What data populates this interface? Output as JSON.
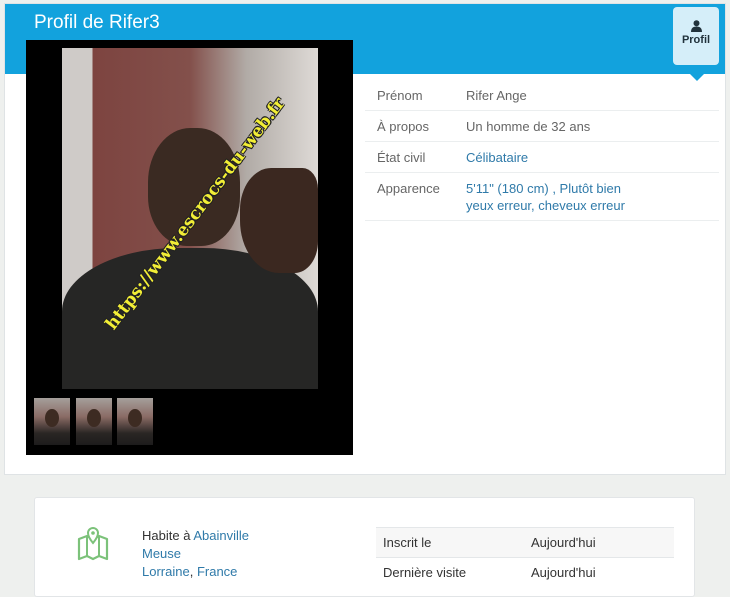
{
  "header": {
    "title": "Profil de Rifer3",
    "tab_label": "Profil",
    "tab_icon": "user-icon"
  },
  "photo": {
    "watermark": "https://www.escrocs-du-web.fr",
    "thumbnail_count": 3
  },
  "info": [
    {
      "label": "Prénom",
      "value": "Rifer Ange"
    },
    {
      "label": "À propos",
      "value": "Un homme de 32 ans"
    },
    {
      "label": "État civil",
      "value": "Célibataire"
    },
    {
      "label": "Apparence",
      "value_line1": "5'11\" (180 cm) , Plutôt bien",
      "value_line2": "yeux erreur, cheveux erreur"
    }
  ],
  "location": {
    "prefix": "Habite à",
    "city": "Abainville",
    "department": "Meuse",
    "region": "Lorraine",
    "separator": ",",
    "country": "France",
    "icon": "map-icon"
  },
  "stats": [
    {
      "label": "Inscrit le",
      "value": "Aujourd'hui"
    },
    {
      "label": "Dernière visite",
      "value": "Aujourd'hui"
    }
  ],
  "colors": {
    "header": "#12a2dd",
    "link": "#2f7aa9",
    "tab_bg": "#d5eef9",
    "map_icon": "#7cc27a"
  }
}
